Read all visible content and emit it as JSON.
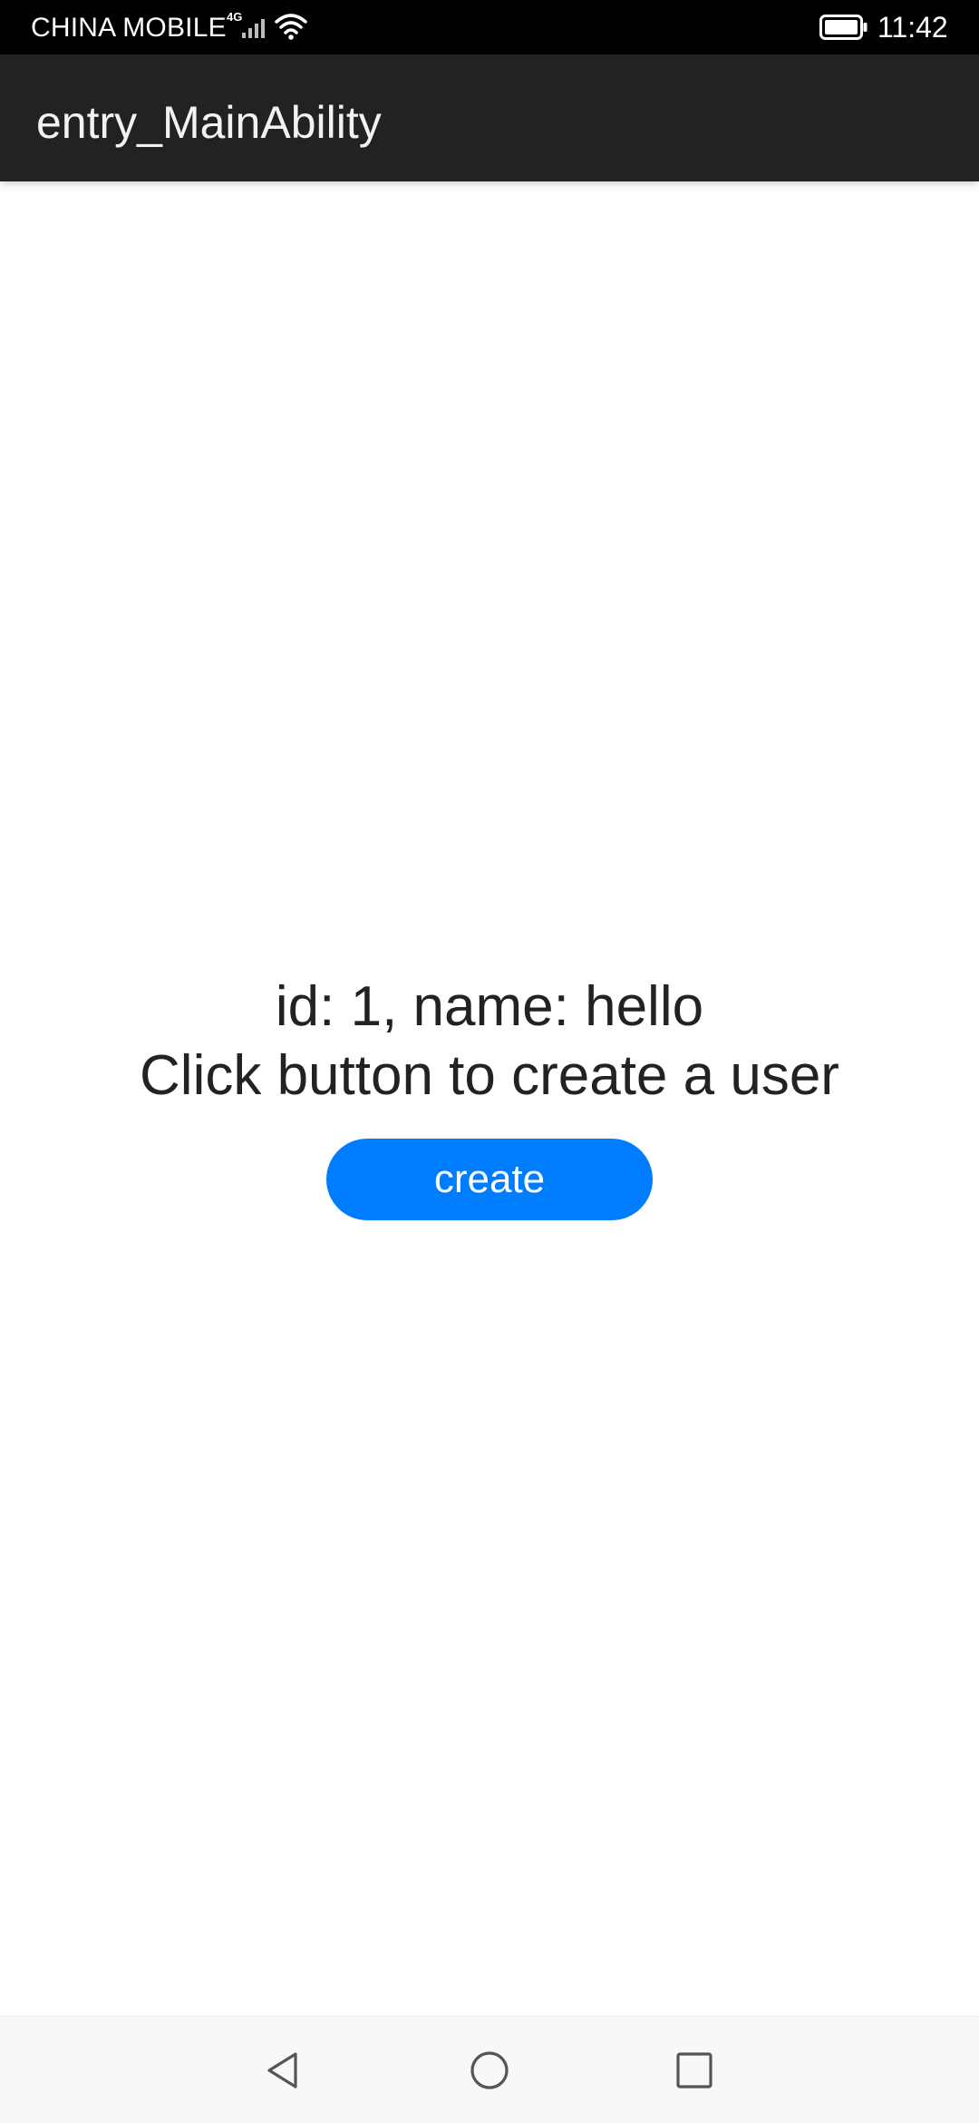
{
  "status_bar": {
    "carrier": "CHINA MOBILE",
    "network_type": "4G",
    "time": "11:42",
    "icons": [
      "signal-icon",
      "wifi-icon",
      "battery-icon"
    ]
  },
  "app_bar": {
    "title": "entry_MainAbility"
  },
  "content": {
    "user_info": "id: 1, name: hello",
    "hint": "Click button to create a user",
    "create_button_label": "create"
  },
  "navigation_bar": {
    "icons": [
      "back-triangle-icon",
      "home-circle-icon",
      "recent-square-icon"
    ]
  },
  "colors": {
    "status_bar_bg": "#000000",
    "app_bar_bg": "#222222",
    "accent": "#007dff",
    "text_primary": "#222222",
    "background": "#ffffff",
    "nav_bar_bg": "#f8f8f8"
  }
}
